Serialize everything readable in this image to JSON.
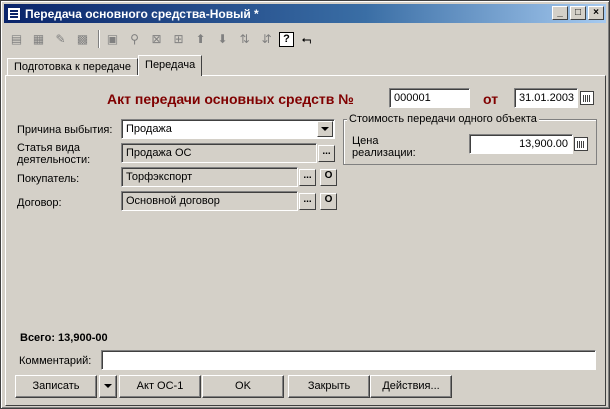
{
  "window": {
    "title": "Передача основного средства-Новый *",
    "min_label": "_",
    "max_label": "□",
    "close_label": "×"
  },
  "toolbar": {
    "icons": [
      "new-icon",
      "copy-icon",
      "edit-icon",
      "delete-icon",
      "find-icon",
      "filter-icon",
      "clear-filter-icon",
      "tree-icon",
      "up-icon",
      "down-icon",
      "sort-asc-icon",
      "sort-desc-icon",
      "help-icon",
      "whats-this-icon"
    ],
    "help_glyph": "?"
  },
  "tabs": [
    {
      "label": "Подготовка к передаче",
      "selected": false
    },
    {
      "label": "Передача",
      "selected": true
    }
  ],
  "form": {
    "heading": "Акт передачи основных средств №",
    "number": "000001",
    "date_prefix": "от",
    "date": "31.01.2003",
    "reason_label": "Причина выбытия:",
    "reason_value": "Продажа",
    "activity_label_1": "Статья вида",
    "activity_label_2": "деятельности:",
    "activity_value": "Продажа ОС",
    "buyer_label": "Покупатель:",
    "buyer_value": "Торфэкспорт",
    "contract_label": "Договор:",
    "contract_value": "Основной договор",
    "ellipsis": "...",
    "open_label": "О",
    "group_title": "Стоимость передачи одного объекта",
    "price_label_1": "Цена",
    "price_label_2": "реализации:",
    "price_value": "13,900.00",
    "total": "Всего: 13,900-00",
    "comment_label": "Комментарий:",
    "comment_value": ""
  },
  "buttons": {
    "save": "Записать",
    "act": "Акт ОС-1",
    "ok": "OK",
    "close": "Закрыть",
    "actions": "Действия..."
  }
}
